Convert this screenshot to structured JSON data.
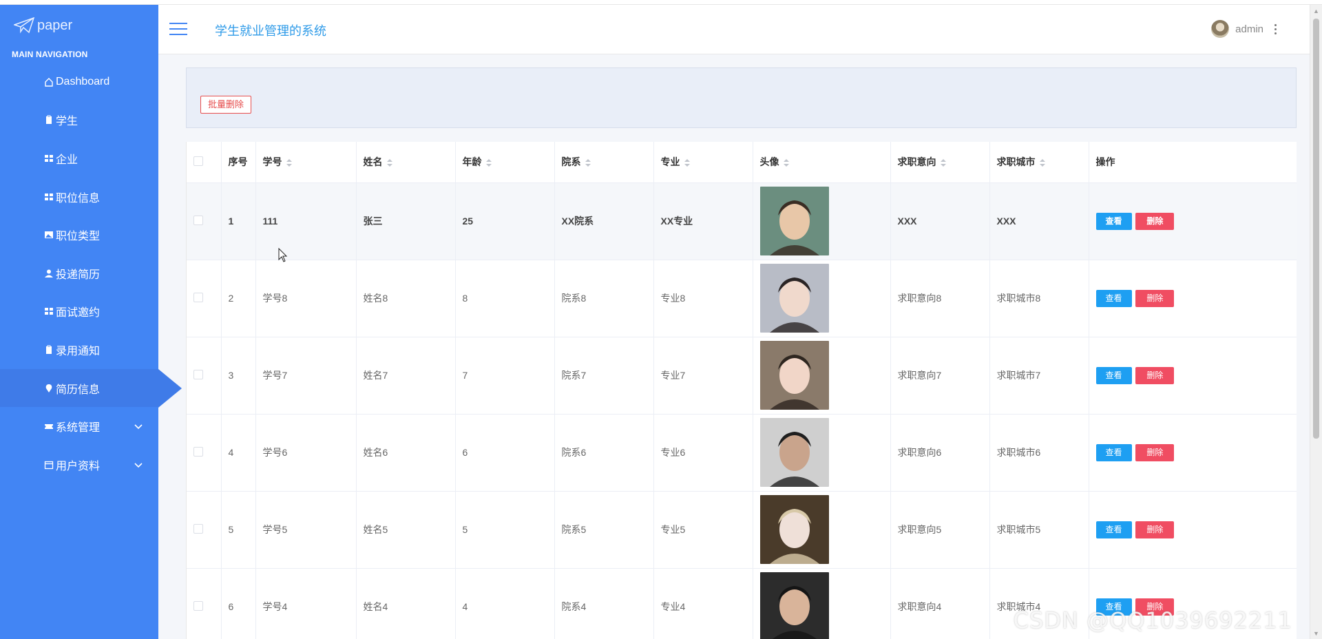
{
  "brand": {
    "name": "paper"
  },
  "sidebar": {
    "caption": "MAIN NAVIGATION",
    "items": [
      {
        "label": "Dashboard",
        "icon": "home-icon"
      },
      {
        "label": "学生",
        "icon": "clipboard-icon"
      },
      {
        "label": "企业",
        "icon": "grid-icon"
      },
      {
        "label": "职位信息",
        "icon": "grid-icon"
      },
      {
        "label": "职位类型",
        "icon": "image-icon"
      },
      {
        "label": "投递简历",
        "icon": "user-icon"
      },
      {
        "label": "面试邀约",
        "icon": "grid-icon"
      },
      {
        "label": "录用通知",
        "icon": "clipboard-icon"
      },
      {
        "label": "简历信息",
        "icon": "pin-icon",
        "active": true
      },
      {
        "label": "系统管理",
        "icon": "ticket-icon",
        "expandable": true
      },
      {
        "label": "用户资料",
        "icon": "calendar-icon",
        "expandable": true
      }
    ]
  },
  "header": {
    "title": "学生就业管理的系统",
    "user": "admin"
  },
  "toolbar": {
    "batch_delete": "批量删除"
  },
  "table": {
    "columns": [
      "序号",
      "学号",
      "姓名",
      "年龄",
      "院系",
      "专业",
      "头像",
      "求职意向",
      "求职城市",
      "操作"
    ],
    "view_label": "查看",
    "delete_label": "删除",
    "rows": [
      {
        "idx": "1",
        "sno": "111",
        "name": "张三",
        "age": "25",
        "dept": "XX院系",
        "major": "XX专业",
        "intent": "XXX",
        "city": "XXX"
      },
      {
        "idx": "2",
        "sno": "学号8",
        "name": "姓名8",
        "age": "8",
        "dept": "院系8",
        "major": "专业8",
        "intent": "求职意向8",
        "city": "求职城市8"
      },
      {
        "idx": "3",
        "sno": "学号7",
        "name": "姓名7",
        "age": "7",
        "dept": "院系7",
        "major": "专业7",
        "intent": "求职意向7",
        "city": "求职城市7"
      },
      {
        "idx": "4",
        "sno": "学号6",
        "name": "姓名6",
        "age": "6",
        "dept": "院系6",
        "major": "专业6",
        "intent": "求职意向6",
        "city": "求职城市6"
      },
      {
        "idx": "5",
        "sno": "学号5",
        "name": "姓名5",
        "age": "5",
        "dept": "院系5",
        "major": "专业5",
        "intent": "求职意向5",
        "city": "求职城市5"
      },
      {
        "idx": "6",
        "sno": "学号4",
        "name": "姓名4",
        "age": "4",
        "dept": "院系4",
        "major": "专业4",
        "intent": "求职意向4",
        "city": "求职城市4"
      }
    ]
  },
  "watermark": "CSDN @QQ1039692211",
  "colors": {
    "sidebar": "#4285f4",
    "accent": "#2f9be8",
    "view": "#1e9ff2",
    "danger": "#f04d62"
  }
}
